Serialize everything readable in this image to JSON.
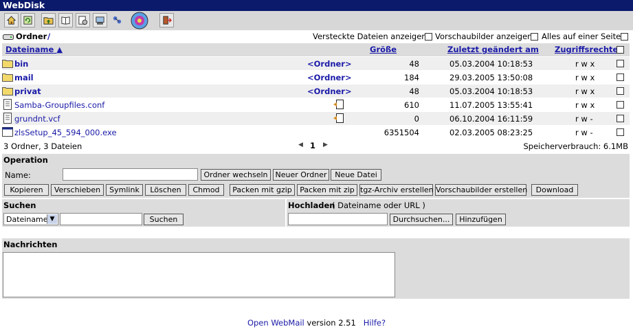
{
  "window": {
    "title": "WebDisk"
  },
  "toolbar": {
    "icons": [
      "home-icon",
      "refresh-icon",
      "folder-up-icon",
      "book-icon",
      "preferences-icon",
      "computer-icon",
      "network-icon",
      "openwebmail-logo-icon",
      "logout-icon"
    ]
  },
  "path": {
    "label": "Ordner",
    "value": "/",
    "opt_hidden": "Versteckte Dateien anzeigen",
    "opt_thumbs": "Vorschaubilder anzeigen",
    "opt_onepage": "Alles auf einer Seite"
  },
  "columns": {
    "name": "Dateiname",
    "sort_arrow": "▲",
    "size": "Größe",
    "modified": "Zuletzt geändert am",
    "perms": "Zugriffsrechte"
  },
  "files": [
    {
      "name": "bin",
      "type": "folder",
      "tag": "<Ordner>",
      "size": "48",
      "date": "05.03.2004 10:18:53",
      "perm": "r w x"
    },
    {
      "name": "mail",
      "type": "folder",
      "tag": "<Ordner>",
      "size": "184",
      "date": "29.03.2005 13:50:08",
      "perm": "r w x"
    },
    {
      "name": "privat",
      "type": "folder",
      "tag": "<Ordner>",
      "size": "48",
      "date": "05.03.2004 10:18:53",
      "perm": "r w x"
    },
    {
      "name": "Samba-Groupfiles.conf",
      "type": "text",
      "tag": "",
      "size": "610",
      "date": "11.07.2005 13:55:41",
      "perm": "r w x"
    },
    {
      "name": "grundnt.vcf",
      "type": "text",
      "tag": "",
      "size": "0",
      "date": "06.10.2004 16:11:59",
      "perm": "r w -"
    },
    {
      "name": "zlsSetup_45_594_000.exe",
      "type": "exe",
      "tag": "",
      "size": "6351504",
      "date": "02.03.2005 08:23:25",
      "perm": "r w -"
    }
  ],
  "summary": {
    "counts": "3 Ordner, 3 Dateien",
    "page": "1",
    "prev": "◀",
    "next": "▶",
    "usage": "Speicherverbrauch: 6.1MB"
  },
  "operation": {
    "title": "Operation",
    "name_label": "Name:",
    "name_value": "",
    "btn_chdir": "Ordner wechseln",
    "btn_newfolder": "Neuer Ordner",
    "btn_newfile": "Neue Datei",
    "actions": [
      "Kopieren",
      "Verschieben",
      "Symlink",
      "Löschen",
      "Chmod",
      "Packen mit gzip",
      "Packen mit zip",
      "tgz-Archiv erstellen",
      "Vorschaubilder erstellen",
      "Download"
    ]
  },
  "search": {
    "title": "Suchen",
    "select_value": "Dateiname",
    "query": "",
    "button": "Suchen"
  },
  "upload": {
    "title": "Hochladen",
    "hint": "( Dateiname oder URL )",
    "value": "",
    "browse": "Durchsuchen...",
    "add": "Hinzufügen"
  },
  "messages": {
    "title": "Nachrichten",
    "text": ""
  },
  "footer": {
    "app": "Open WebMail",
    "version": "version 2.51",
    "help": "Hilfe?"
  }
}
